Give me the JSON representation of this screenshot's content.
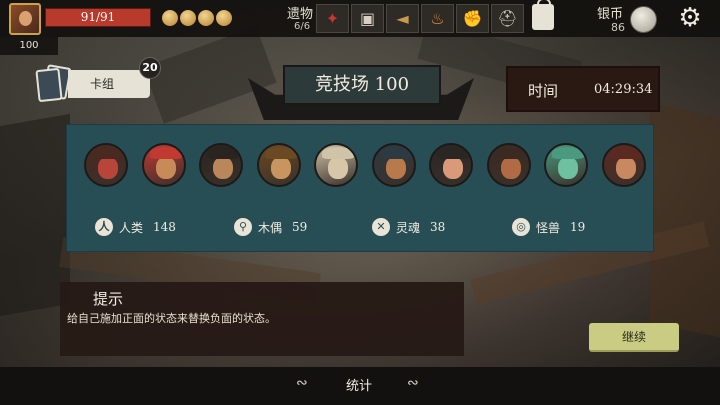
{
  "hud": {
    "hp": "91/91",
    "gold_count": 4,
    "level": "100",
    "relics_label": "遗物",
    "relics_count": "6/6",
    "relics": [
      {
        "icon": "red-bird-icon"
      },
      {
        "icon": "treasure-map-icon"
      },
      {
        "icon": "horn-icon"
      },
      {
        "icon": "torch-icon"
      },
      {
        "icon": "gauntlet-icon"
      },
      {
        "icon": "viking-helmet-icon"
      }
    ],
    "silver_label": "银币",
    "silver_count": "86"
  },
  "deck": {
    "label": "卡组",
    "count": "20"
  },
  "arena": {
    "title": "竞技场 100",
    "time_label": "时间",
    "time_value": "04:29:34"
  },
  "opponents": [
    {
      "skin": "#b8453a",
      "hat": "#4a2a20"
    },
    {
      "skin": "#c98a5a",
      "hat": "#c03a32"
    },
    {
      "skin": "#b9875a",
      "hat": "#2a2420"
    },
    {
      "skin": "#c89560",
      "hat": "#6a4a22"
    },
    {
      "skin": "#d7c6a8",
      "hat": "#cfc4a8"
    },
    {
      "skin": "#b87a4a",
      "hat": "#2e3a42"
    },
    {
      "skin": "#d89a78",
      "hat": "#2a2624"
    },
    {
      "skin": "#b06a44",
      "hat": "#3a2a22"
    },
    {
      "skin": "#6fc0a0",
      "hat": "#4a9a80"
    },
    {
      "skin": "#c88860",
      "hat": "#5a2a22"
    }
  ],
  "stats": [
    {
      "icon": "human-icon",
      "glyph": "人",
      "label": "人类",
      "value": "148"
    },
    {
      "icon": "puppet-icon",
      "glyph": "⚲",
      "label": "木偶",
      "value": "59"
    },
    {
      "icon": "soul-icon",
      "glyph": "✕",
      "label": "灵魂",
      "value": "38"
    },
    {
      "icon": "beast-icon",
      "glyph": "◎",
      "label": "怪兽",
      "value": "19"
    }
  ],
  "tip": {
    "title": "提示",
    "text": "给自己施加正面的状态来替换负面的状态。"
  },
  "buttons": {
    "continue": "继续",
    "stats": "统计"
  },
  "colors": {
    "panel": "#284e55",
    "hp": "#b83a2c",
    "continue": "#c9cc82",
    "tip_bg": "#261a16"
  }
}
